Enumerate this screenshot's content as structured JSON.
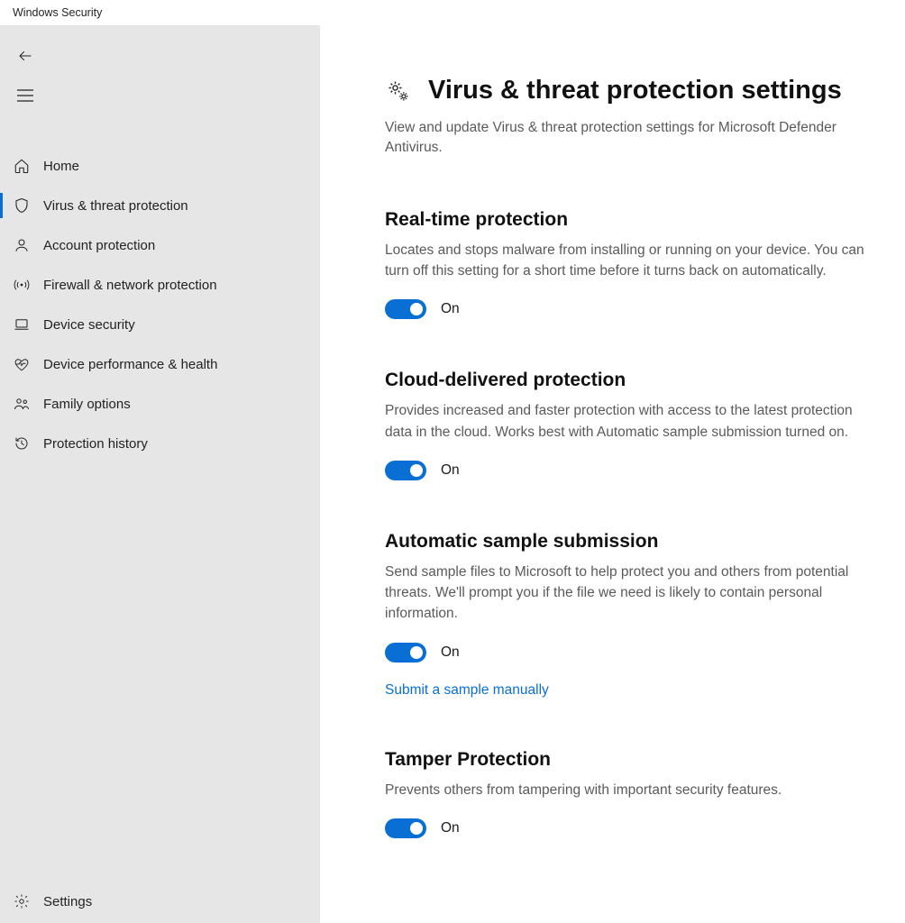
{
  "window": {
    "title": "Windows Security"
  },
  "sidebar": {
    "items": [
      {
        "label": "Home"
      },
      {
        "label": "Virus & threat protection"
      },
      {
        "label": "Account protection"
      },
      {
        "label": "Firewall & network protection"
      },
      {
        "label": "Device security"
      },
      {
        "label": "Device performance & health"
      },
      {
        "label": "Family options"
      },
      {
        "label": "Protection history"
      }
    ],
    "settings_label": "Settings"
  },
  "page": {
    "title": "Virus & threat protection settings",
    "description": "View and update Virus & threat protection settings for Microsoft Defender Antivirus."
  },
  "sections": [
    {
      "title": "Real-time protection",
      "description": "Locates and stops malware from installing or running on your device. You can turn off this setting for a short time before it turns back on automatically.",
      "toggle_state": "On"
    },
    {
      "title": "Cloud-delivered protection",
      "description": "Provides increased and faster protection with access to the latest protection data in the cloud. Works best with Automatic sample submission turned on.",
      "toggle_state": "On"
    },
    {
      "title": "Automatic sample submission",
      "description": "Send sample files to Microsoft to help protect you and others from potential threats. We'll prompt you if the file we need is likely to contain personal information.",
      "toggle_state": "On",
      "link": "Submit a sample manually"
    },
    {
      "title": "Tamper Protection",
      "description": "Prevents others from tampering with important security features.",
      "toggle_state": "On"
    }
  ]
}
